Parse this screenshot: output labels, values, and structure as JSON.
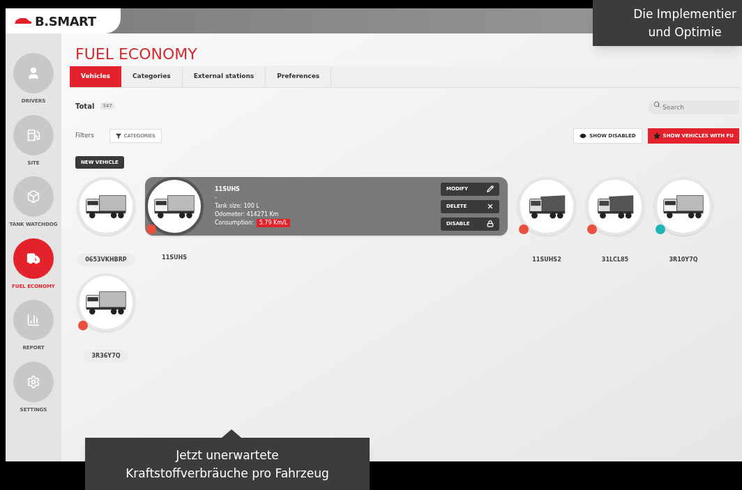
{
  "logo": "B.SMART",
  "sidebar": {
    "items": [
      {
        "label": "DRIVERS",
        "selected": false
      },
      {
        "label": "SITE",
        "selected": false
      },
      {
        "label": "TANK WATCHDOG",
        "selected": false
      },
      {
        "label": "FUEL ECONOMY",
        "selected": true
      },
      {
        "label": "REPORT",
        "selected": false
      },
      {
        "label": "SETTINGS",
        "selected": false
      }
    ]
  },
  "page_title": "FUEL ECONOMY",
  "tabs": [
    {
      "label": "Vehicles",
      "selected": true
    },
    {
      "label": "Categories",
      "selected": false
    },
    {
      "label": "External stations",
      "selected": false
    },
    {
      "label": "Preferences",
      "selected": false
    }
  ],
  "total": {
    "label": "Total",
    "count": "347"
  },
  "search": {
    "placeholder": "Search"
  },
  "filters": {
    "label": "Filters",
    "categories_button": "CATEGORIES"
  },
  "toggles": [
    {
      "label": "SHOW DISABLED",
      "on": false
    },
    {
      "label": "SHOW VEHICLES WITH FU",
      "on": true
    }
  ],
  "new_vehicle_button": "NEW VEHICLE",
  "vehicle_rows": [
    [
      {
        "name": "0653VKHBRP",
        "kind": "box",
        "selected": false
      },
      {
        "name": "11SUHS",
        "kind": "box",
        "color": "#e8513f",
        "selected": true,
        "details": {
          "title": "11SUHS",
          "subtitle": "-",
          "tank": "Tank size: 100 L",
          "odometer": "Odometer: 414271 Km",
          "consumption_label": "Consumption:",
          "consumption": "5.79 Km/L"
        },
        "actions": [
          "MODIFY",
          "DELETE",
          "DISABLE"
        ]
      },
      {
        "name": "11SUHS2",
        "kind": "dump",
        "color": "#e8513f",
        "selected": false
      },
      {
        "name": "31LCL85",
        "kind": "dump",
        "color": "#e8513f",
        "selected": false
      },
      {
        "name": "3R10Y7Q",
        "kind": "box",
        "color": "#1fb3b8",
        "selected": false
      }
    ],
    [
      {
        "name": "3R36Y7Q",
        "kind": "box",
        "color": "#e8513f",
        "selected": false
      }
    ]
  ],
  "callouts": [
    [
      "Die Implementier",
      "und Optimie"
    ],
    [
      "Jetzt unerwartete",
      "Kraftstoffverbräuche pro Fahrzeug"
    ]
  ]
}
